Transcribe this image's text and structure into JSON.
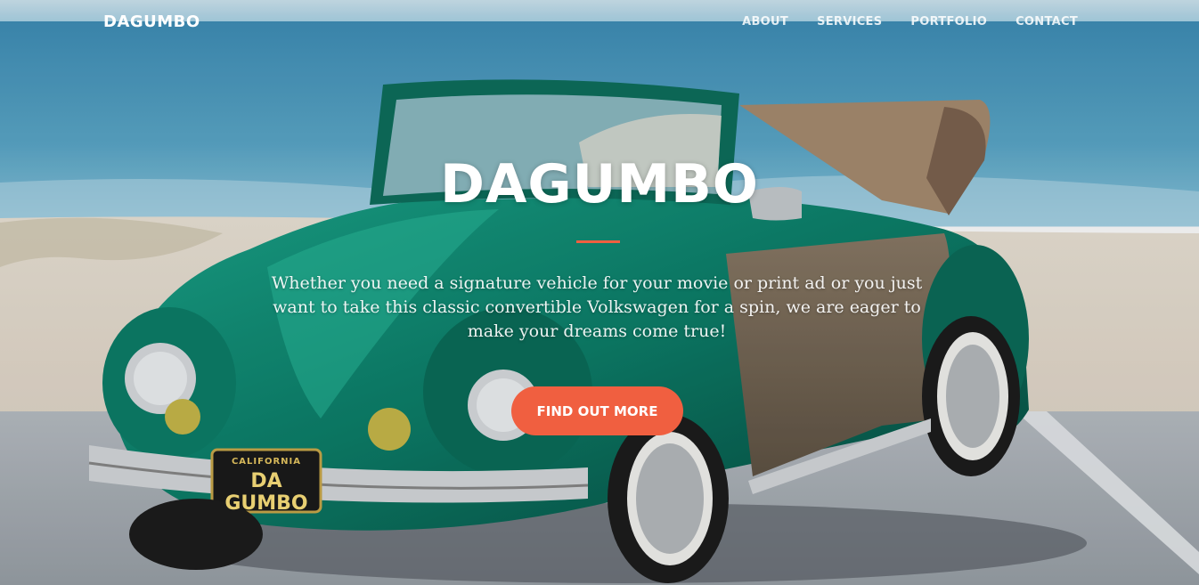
{
  "navbar": {
    "brand": "DAGUMBO",
    "links": [
      {
        "label": "ABOUT"
      },
      {
        "label": "SERVICES"
      },
      {
        "label": "PORTFOLIO"
      },
      {
        "label": "CONTACT"
      }
    ]
  },
  "hero": {
    "title": "DAGUMBO",
    "text": "Whether you need a signature vehicle for your movie or print ad or you just want to take this classic convertible Volkswagen for a spin, we are eager to make your dreams come true!",
    "button_label": "FIND OUT MORE",
    "plate_state": "CALIFORNIA",
    "plate_text": "DA GUMBO"
  },
  "colors": {
    "accent": "#f05f40",
    "car_green": "#0f8a72",
    "ocean": "#4a9cc0",
    "sand": "#e6ddd0"
  }
}
